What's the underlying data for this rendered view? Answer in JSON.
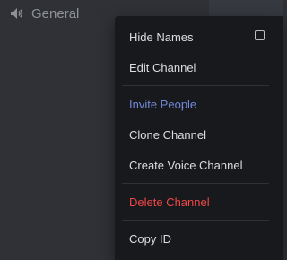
{
  "channel": {
    "name": "General",
    "icon": "speaker-icon"
  },
  "context_menu": {
    "items": [
      {
        "label": "Hide Names",
        "has_checkbox": true,
        "checked": false
      },
      {
        "label": "Edit Channel"
      },
      {
        "label": "Invite People"
      },
      {
        "label": "Clone Channel"
      },
      {
        "label": "Create Voice Channel"
      },
      {
        "label": "Delete Channel"
      },
      {
        "label": "Copy ID"
      }
    ]
  },
  "colors": {
    "sidebar_bg": "#2f3136",
    "chat_bg": "#36393f",
    "menu_bg": "#18191c",
    "text_normal": "#dcddde",
    "invite_accent": "#7289da",
    "danger": "#f04747",
    "muted_channel": "#8e9297"
  }
}
